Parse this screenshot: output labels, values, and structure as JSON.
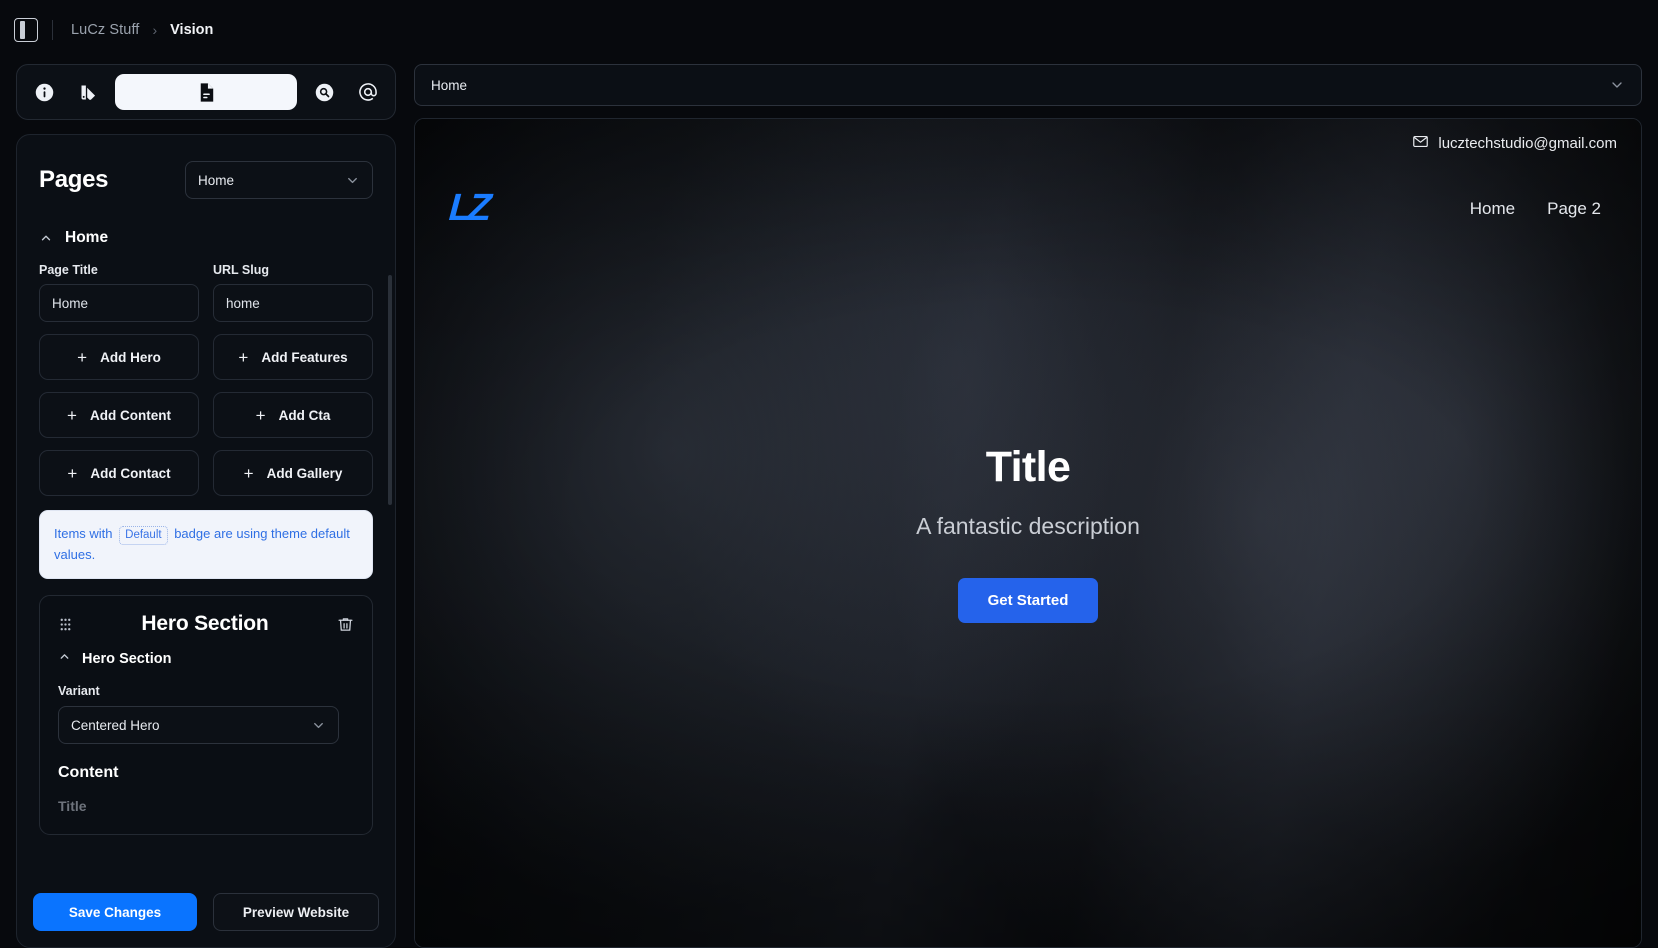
{
  "topbar": {
    "panel_toggle_icon": "panel-left-icon",
    "breadcrumb_root": "LuCz Stuff",
    "breadcrumb_sep": "›",
    "breadcrumb_current": "Vision"
  },
  "icon_rail": {
    "items": [
      {
        "icon": "info-icon",
        "active": false
      },
      {
        "icon": "palette-icon",
        "active": false
      },
      {
        "icon": "document-icon",
        "active": true
      },
      {
        "icon": "search-icon",
        "active": false
      },
      {
        "icon": "at-sign-icon",
        "active": false
      }
    ]
  },
  "pages_panel": {
    "title": "Pages",
    "page_select_value": "Home",
    "accordion": {
      "label": "Home",
      "expanded": true
    },
    "fields": [
      {
        "label": "Page Title",
        "value": "Home"
      },
      {
        "label": "URL Slug",
        "value": "home"
      }
    ],
    "add_buttons": [
      "Add Hero",
      "Add Features",
      "Add Content",
      "Add Cta",
      "Add Contact",
      "Add Gallery"
    ],
    "plus_glyph": "+",
    "notice": {
      "text_before": "Items with",
      "badge": "Default",
      "text_after": "badge are using theme default values."
    },
    "section_card": {
      "drag_icon": "drag-handle-icon",
      "title": "Hero Section",
      "delete_icon": "trash-icon",
      "sub_accordion": "Hero Section",
      "variant_label": "Variant",
      "variant_value": "Centered Hero",
      "content_heading": "Content",
      "next_field_label": "Title"
    }
  },
  "footer": {
    "save_label": "Save Changes",
    "preview_label": "Preview Website",
    "accent": "#0a74ff"
  },
  "preview": {
    "page_select_value": "Home",
    "site": {
      "email": "lucztechstudio@gmail.com",
      "email_icon": "mail-icon",
      "logo_text": "LZ",
      "logo_color": "#1a7cff",
      "nav_links": [
        "Home",
        "Page 2"
      ],
      "hero_title": "Title",
      "hero_description": "A fantastic description",
      "cta_label": "Get Started",
      "cta_color": "#2563eb"
    }
  }
}
